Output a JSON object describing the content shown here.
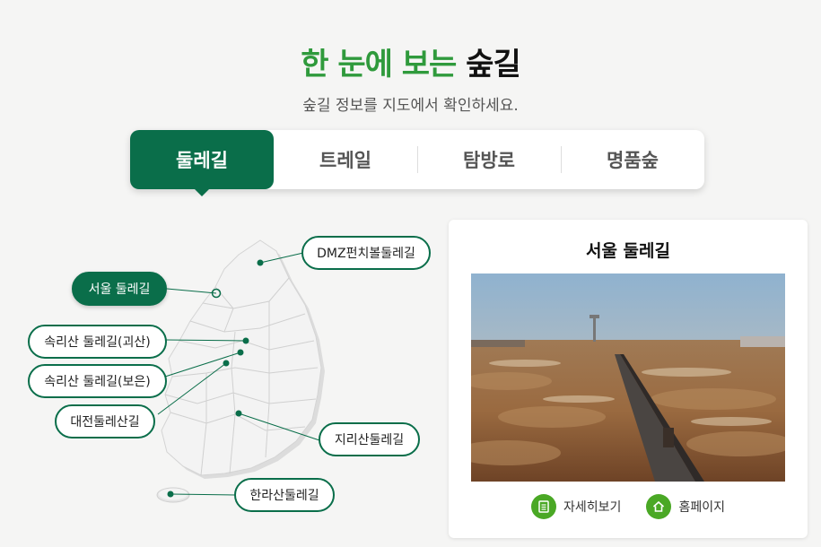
{
  "header": {
    "title_accent": "한 눈에 보는",
    "title_dark": "숲길",
    "subtitle": "숲길 정보를 지도에서 확인하세요."
  },
  "tabs": [
    {
      "label": "둘레길",
      "active": true
    },
    {
      "label": "트레일",
      "active": false
    },
    {
      "label": "탐방로",
      "active": false
    },
    {
      "label": "명품숲",
      "active": false
    }
  ],
  "map": {
    "labels": {
      "dmz": "DMZ펀치볼둘레길",
      "seoul": "서울 둘레길",
      "songni_goesan": "속리산 둘레길(괴산)",
      "songni_boeun": "속리산 둘레길(보은)",
      "daejeon": "대전둘레산길",
      "jiri": "지리산둘레길",
      "halla": "한라산둘레길"
    }
  },
  "card": {
    "title": "서울 둘레길",
    "detail_label": "자세히보기",
    "homepage_label": "홈페이지"
  },
  "colors": {
    "primary": "#0a6e4a",
    "accent": "#2f9a3c",
    "action": "#4aa825"
  }
}
